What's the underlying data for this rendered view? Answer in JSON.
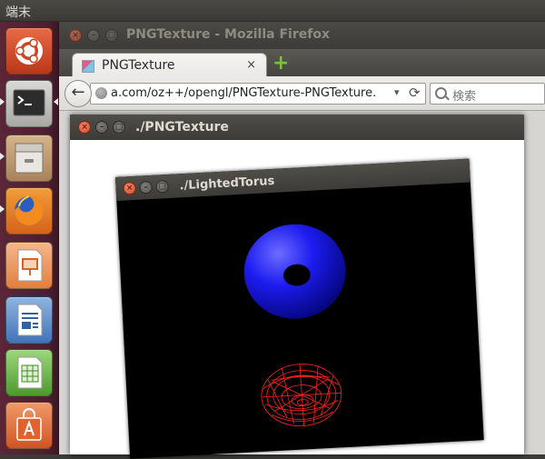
{
  "top_panel": {
    "app_name": "端末"
  },
  "launcher": {
    "items": [
      {
        "name": "Ubuntu Dash",
        "icon": "ubuntu-logo-icon"
      },
      {
        "name": "Terminal",
        "icon": "terminal-icon"
      },
      {
        "name": "Files",
        "icon": "file-cabinet-icon"
      },
      {
        "name": "Firefox",
        "icon": "firefox-icon"
      },
      {
        "name": "LibreOffice Impress",
        "icon": "presentation-icon"
      },
      {
        "name": "LibreOffice Writer",
        "icon": "document-icon"
      },
      {
        "name": "LibreOffice Calc",
        "icon": "spreadsheet-icon"
      },
      {
        "name": "Ubuntu Software Center",
        "icon": "shopping-bag-icon"
      }
    ]
  },
  "firefox": {
    "title": "PNGTexture - Mozilla Firefox",
    "tab_label": "PNGTexture",
    "tab_close": "×",
    "new_tab": "+",
    "back_arrow": "←",
    "url": "a.com/oz++/opengl/PNGTexture-PNGTexture.",
    "url_dropdown": "▾",
    "reload": "⟳",
    "search_placeholder": "検索"
  },
  "png_window": {
    "title": "./PNGTexture"
  },
  "torus_window": {
    "title": "./LightedTorus"
  },
  "colors": {
    "launcher_bg": "#4c1f30",
    "close_button": "#e0542f",
    "solid_torus": "#1a1aff",
    "wire_torus": "#ff2020"
  }
}
